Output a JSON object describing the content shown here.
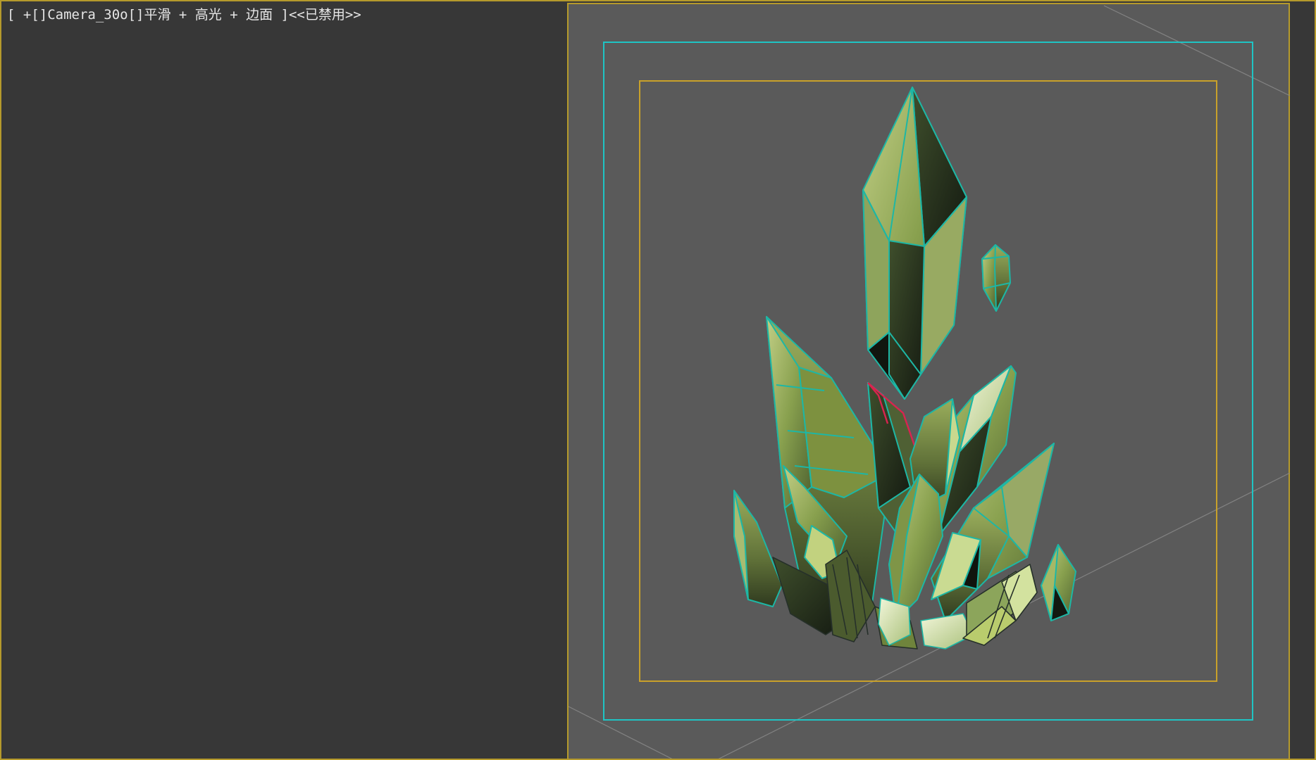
{
  "viewport": {
    "label": "[ +[]Camera_30o[]平滑 + 高光 + 边面 ]<<已禁用>>",
    "view_mode": "camera",
    "shading": "smooth + highlights + edged faces",
    "status": "disabled"
  },
  "colors": {
    "background": "#373737",
    "render_region": "#5a5a5a",
    "viewport_border": "#b59a2c",
    "safe_frame_outer": "#1fc4c4",
    "safe_frame_inner": "#c9a12a",
    "wire_edges": "#1db7a5",
    "selected_edge": "#d9234f",
    "crystal_light": "#a6b865",
    "crystal_mid": "#6d7f3c",
    "crystal_dark": "#1f2a1b"
  },
  "scene": {
    "object": "green crystal cluster",
    "icons": [
      "camera-frustum-lines"
    ]
  }
}
